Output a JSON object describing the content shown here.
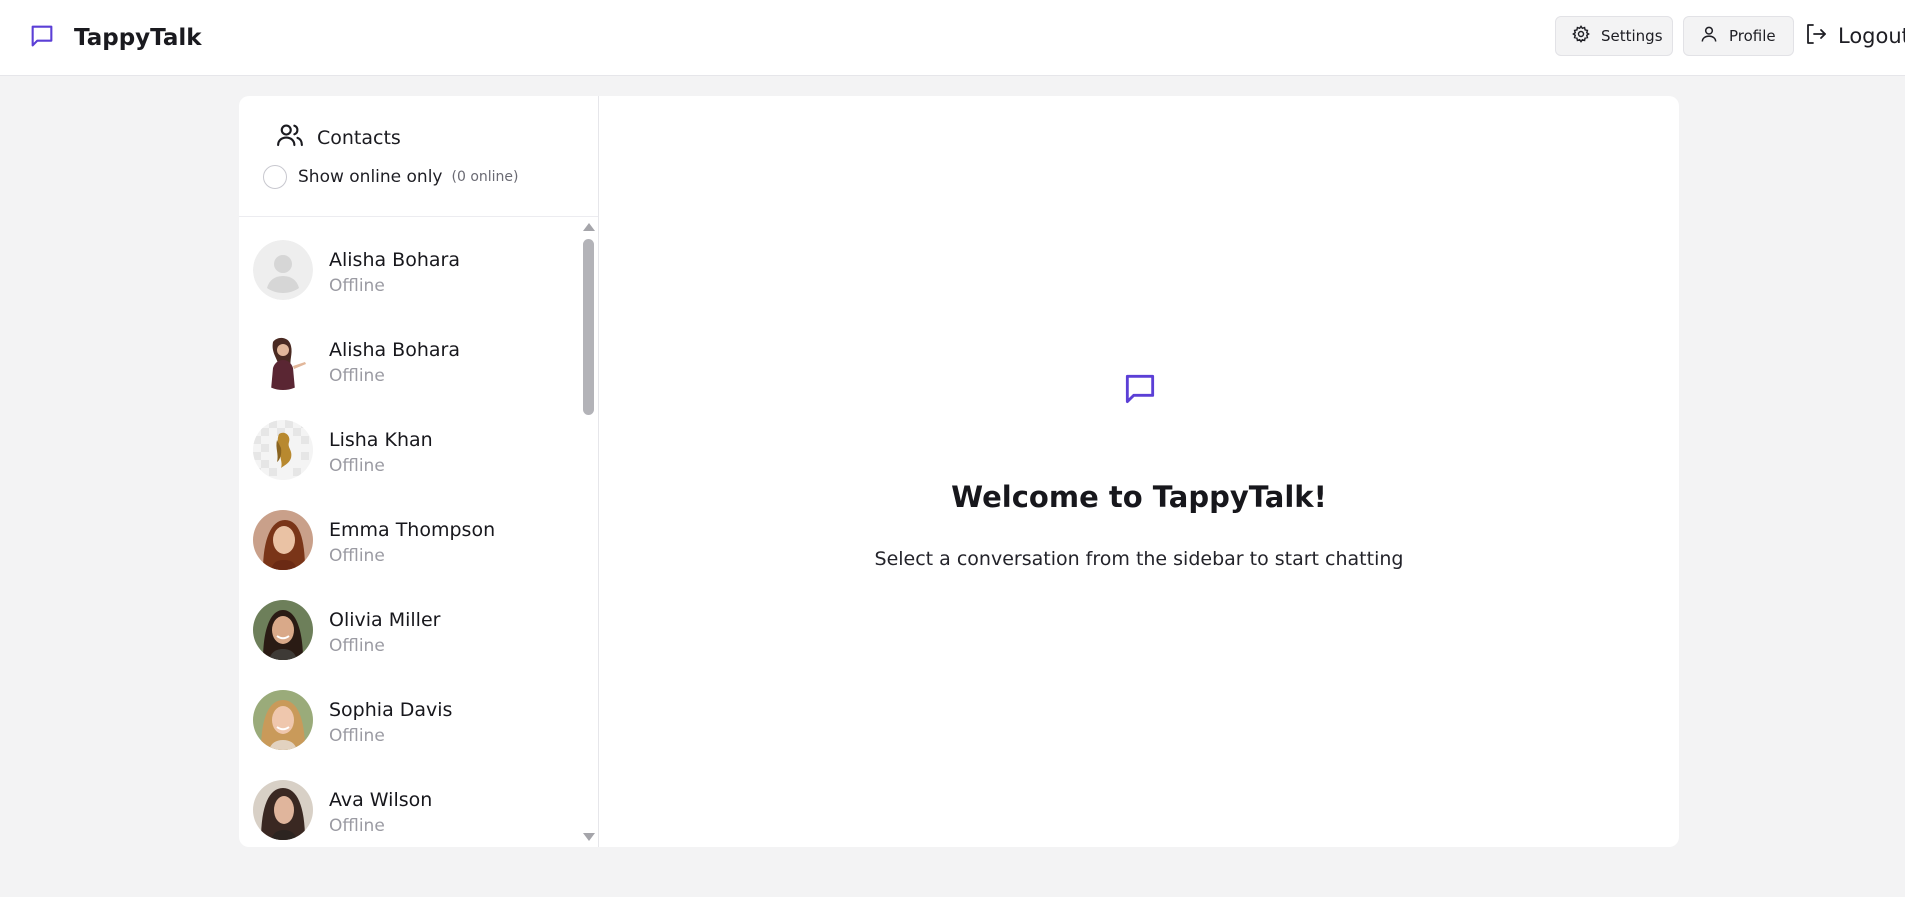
{
  "app": {
    "name": "TappyTalk",
    "brand_color": "#5b3fd6"
  },
  "nav": {
    "settings_label": "Settings",
    "profile_label": "Profile",
    "logout_label": "Logout"
  },
  "sidebar": {
    "title": "Contacts",
    "filter_label": "Show online only",
    "online_count": "(0 online)",
    "filter_checked": false,
    "contacts": [
      {
        "name": "Alisha Bohara",
        "status": "Offline",
        "avatar": "default-avatar-icon"
      },
      {
        "name": "Alisha Bohara",
        "status": "Offline",
        "avatar": "photo"
      },
      {
        "name": "Lisha Khan",
        "status": "Offline",
        "avatar": "photo"
      },
      {
        "name": "Emma Thompson",
        "status": "Offline",
        "avatar": "photo"
      },
      {
        "name": "Olivia Miller",
        "status": "Offline",
        "avatar": "photo"
      },
      {
        "name": "Sophia Davis",
        "status": "Offline",
        "avatar": "photo"
      },
      {
        "name": "Ava Wilson",
        "status": "Offline",
        "avatar": "photo"
      }
    ]
  },
  "welcome": {
    "title": "Welcome to TappyTalk!",
    "subtitle": "Select a conversation from the sidebar to start chatting"
  }
}
